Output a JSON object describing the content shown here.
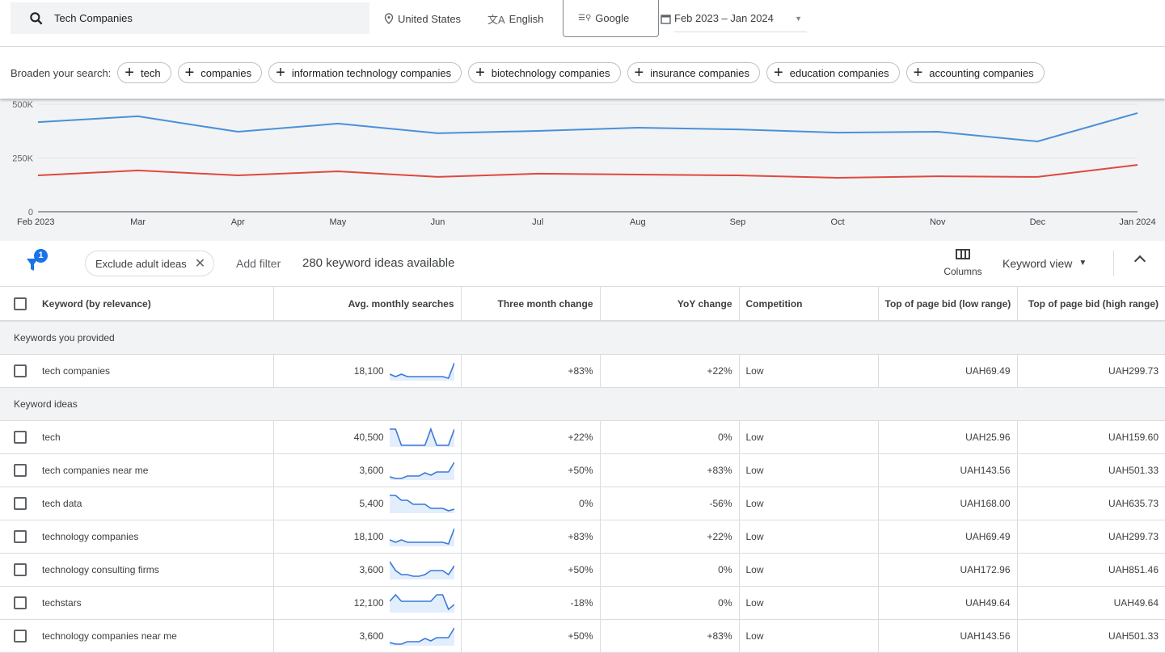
{
  "header": {
    "search_value": "Tech Companies",
    "location": "United States",
    "language": "English",
    "network": "Google",
    "date_range": "Feb 2023 – Jan 2024"
  },
  "broaden": {
    "label": "Broaden your search:",
    "chips": [
      "tech",
      "companies",
      "information technology companies",
      "biotechnology companies",
      "insurance companies",
      "education companies",
      "accounting companies"
    ]
  },
  "chart_data": {
    "type": "line",
    "x": [
      "Feb 2023",
      "Mar",
      "Apr",
      "May",
      "Jun",
      "Jul",
      "Aug",
      "Sep",
      "Oct",
      "Nov",
      "Dec",
      "Jan 2024"
    ],
    "yticks": [
      "0",
      "250K",
      "500K"
    ],
    "ylim": [
      0,
      500000
    ],
    "grid": true,
    "series": [
      {
        "color": "#4a90d9",
        "values": [
          417000,
          444000,
          372000,
          410000,
          365000,
          376000,
          391000,
          383000,
          368000,
          372000,
          327000,
          459000
        ]
      },
      {
        "color": "#e0483e",
        "values": [
          169000,
          192000,
          169000,
          188000,
          162000,
          177000,
          173000,
          169000,
          158000,
          165000,
          162000,
          218000
        ]
      }
    ]
  },
  "toolbar": {
    "filter_count": "1",
    "exclude_chip": "Exclude adult ideas",
    "add_filter": "Add filter",
    "ideas_count": "280 keyword ideas available",
    "columns": "Columns",
    "view": "Keyword view"
  },
  "table": {
    "headers": [
      "Keyword (by relevance)",
      "Avg. monthly searches",
      "Three month change",
      "YoY change",
      "Competition",
      "Top of page bid (low range)",
      "Top of page bid (high range)"
    ],
    "group_provided": "Keywords you provided",
    "group_ideas": "Keyword ideas",
    "provided": [
      {
        "keyword": "tech companies",
        "avg": "18,100",
        "three": "+83%",
        "yoy": "+22%",
        "comp": "Low",
        "low": "UAH69.49",
        "high": "UAH299.73",
        "trend": [
          0.3,
          0.15,
          0.3,
          0.15,
          0.15,
          0.15,
          0.15,
          0.15,
          0.15,
          0.15,
          0.05,
          1
        ]
      }
    ],
    "ideas": [
      {
        "keyword": "tech",
        "avg": "40,500",
        "three": "+22%",
        "yoy": "0%",
        "comp": "Low",
        "low": "UAH25.96",
        "high": "UAH159.60",
        "trend": [
          1,
          1,
          0,
          0,
          0,
          0,
          0,
          1,
          0,
          0,
          0,
          1
        ]
      },
      {
        "keyword": "tech companies near me",
        "avg": "3,600",
        "three": "+50%",
        "yoy": "+83%",
        "comp": "Low",
        "low": "UAH143.56",
        "high": "UAH501.33",
        "trend": [
          0.1,
          0,
          0,
          0.15,
          0.15,
          0.15,
          0.35,
          0.2,
          0.4,
          0.4,
          0.4,
          1
        ]
      },
      {
        "keyword": "tech data",
        "avg": "5,400",
        "three": "0%",
        "yoy": "-56%",
        "comp": "Low",
        "low": "UAH168.00",
        "high": "UAH635.73",
        "trend": [
          1,
          1,
          0.7,
          0.7,
          0.45,
          0.45,
          0.45,
          0.2,
          0.2,
          0.2,
          0.05,
          0.15
        ]
      },
      {
        "keyword": "technology companies",
        "avg": "18,100",
        "three": "+83%",
        "yoy": "+22%",
        "comp": "Low",
        "low": "UAH69.49",
        "high": "UAH299.73",
        "trend": [
          0.3,
          0.15,
          0.3,
          0.15,
          0.15,
          0.15,
          0.15,
          0.15,
          0.15,
          0.15,
          0.05,
          1
        ]
      },
      {
        "keyword": "technology consulting firms",
        "avg": "3,600",
        "three": "+50%",
        "yoy": "0%",
        "comp": "Low",
        "low": "UAH172.96",
        "high": "UAH851.46",
        "trend": [
          1,
          0.45,
          0.2,
          0.2,
          0.1,
          0.1,
          0.2,
          0.45,
          0.45,
          0.45,
          0.2,
          0.75
        ]
      },
      {
        "keyword": "techstars",
        "avg": "12,100",
        "three": "-18%",
        "yoy": "0%",
        "comp": "Low",
        "low": "UAH49.64",
        "high": "UAH49.64",
        "trend": [
          0.6,
          1,
          0.6,
          0.6,
          0.6,
          0.6,
          0.6,
          0.6,
          1,
          1,
          0.1,
          0.4
        ]
      },
      {
        "keyword": "technology companies near me",
        "avg": "3,600",
        "three": "+50%",
        "yoy": "+83%",
        "comp": "Low",
        "low": "UAH143.56",
        "high": "UAH501.33",
        "trend": [
          0.1,
          0,
          0,
          0.15,
          0.15,
          0.15,
          0.35,
          0.2,
          0.4,
          0.4,
          0.4,
          1
        ]
      }
    ]
  }
}
